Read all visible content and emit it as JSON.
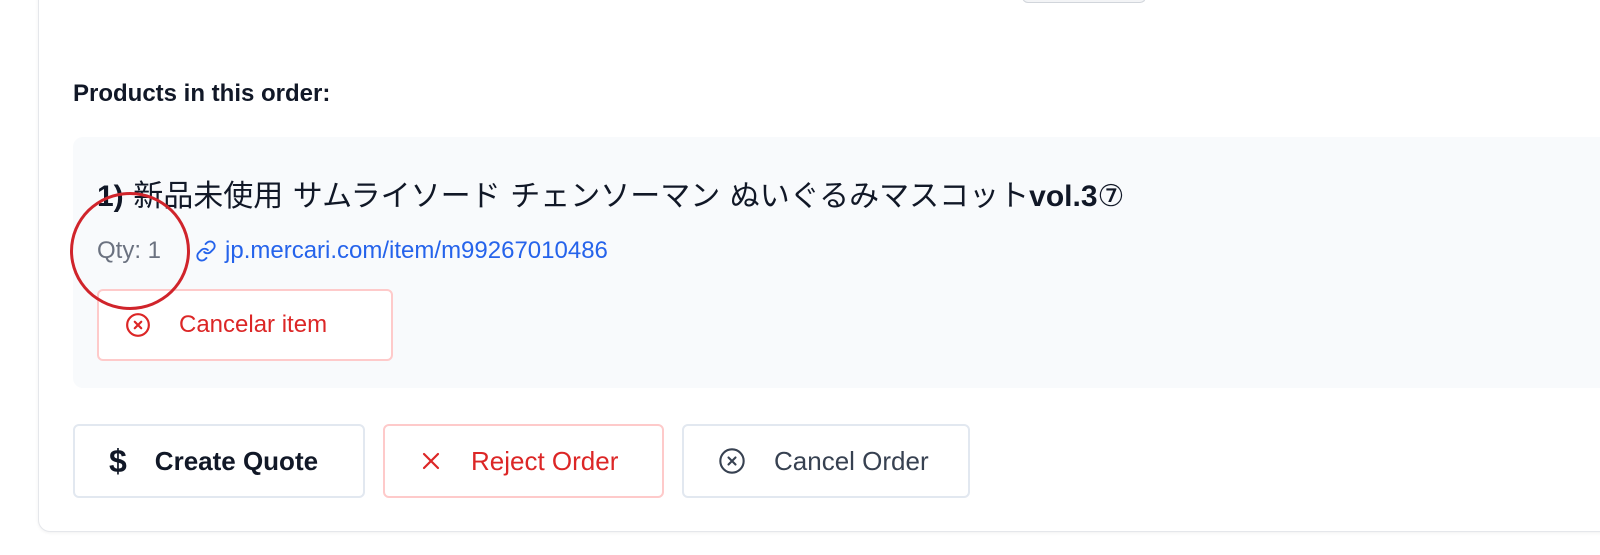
{
  "order": {
    "products_label": "Products in this order:",
    "items": [
      {
        "index": "1)",
        "title_jp": "新品未使用 サムライソード チェンソーマン ぬいぐるみマスコット",
        "title_bold": "vol.3",
        "title_suffix": "⑦",
        "qty": "Qty: 1",
        "link": "jp.mercari.com/item/m99267010486",
        "cancel_label": "Cancelar item"
      }
    ]
  },
  "actions": {
    "create_quote": "Create Quote",
    "reject_order": "Reject Order",
    "cancel_order": "Cancel Order"
  },
  "icons": {
    "create_quote": "dollar-icon",
    "reject_order": "x-icon",
    "cancel_order": "circle-x-icon",
    "cancel_item": "circle-x-icon",
    "link": "link-icon"
  },
  "colors": {
    "danger": "#dc2626",
    "link": "#2563eb",
    "highlight": "#d0242b",
    "panel_bg": "#f8fafc"
  }
}
